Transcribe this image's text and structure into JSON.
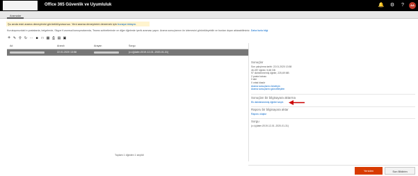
{
  "header": {
    "title": "Office 365 Güvenlik ve Uyumluluk",
    "icons": [
      "bell-icon",
      "gear-icon",
      "help-icon"
    ],
    "avatar_initials": "AA",
    "avatar_color": "#c0392b"
  },
  "tabs": [
    {
      "label": "Aramalar"
    }
  ],
  "notice": {
    "text": "Şu anda eski arama deneyimini görüntülüyorsunuz. Yeni arama deneyimini denemek için ",
    "link": "buraya tıklayın."
  },
  "description": {
    "text": "Kuruluşunuzdaki e-postalarda, belgelerde, Skype Kurumsal konuşmalarında, Teams sohbetlerinde ve diğer öğelerde içerik araması yapın. Arama sonuçlarının ön izlemesini görüntüleyebilir ve bunları dışarı aktarabilirsiniz.",
    "link": "Daha fazla bilgi"
  },
  "toolbar": {
    "icons": [
      "add-icon",
      "edit-icon",
      "search-icon",
      "refresh-icon",
      "more-icon",
      "stop-icon",
      "square-icon",
      "grid-icon",
      "print-icon",
      "calendar-icon",
      "calculator-icon"
    ]
  },
  "table": {
    "columns": [
      "Ad",
      "Arandı",
      "Arayan",
      "Sorgu"
    ],
    "rows": [
      {
        "name": "",
        "searched": "22.01.2020 13:58",
        "searcher": "",
        "query": "(c:c)(date=2019-12-01..2020-01-31)"
      }
    ]
  },
  "pager": "Toplam 1 öğeden 1 seçildi",
  "details": {
    "results": {
      "title": "Sonuçlar",
      "lines": [
        "Son çalıştırma tarihi: 22.01.2020 13:58",
        "46.287 öğeler, 5,68 GB",
        "97 dizinlenmemiş öğeler, 225,69 MB",
        "2 posta kutusu",
        "0 site",
        "0 ortak klasör"
      ],
      "links": [
        "Arama sonuçlarını önizleyin",
        "Arama sonuçlarını güncelleştirin"
      ]
    },
    "export": {
      "title": "Sonuçları bir bilgisayara aktarma",
      "link": "Ek dizinlenmemiş öğeleri seçin"
    },
    "report": {
      "title": "Raporu bir bilgisayara aktar",
      "link": "Raporu oluştur"
    },
    "query": {
      "title": "Sorgu",
      "value": "(c:c)(date=2019-12-01..2020-01-31)"
    }
  },
  "actions": {
    "primary": "Yeniden",
    "secondary": "Son Bildirim"
  },
  "colors": {
    "accent": "#d83b01",
    "link": "#0064c8",
    "notice_bg": "#fff4ce",
    "selected_row": "#777777",
    "annotation_arrow": "#cc0000"
  }
}
